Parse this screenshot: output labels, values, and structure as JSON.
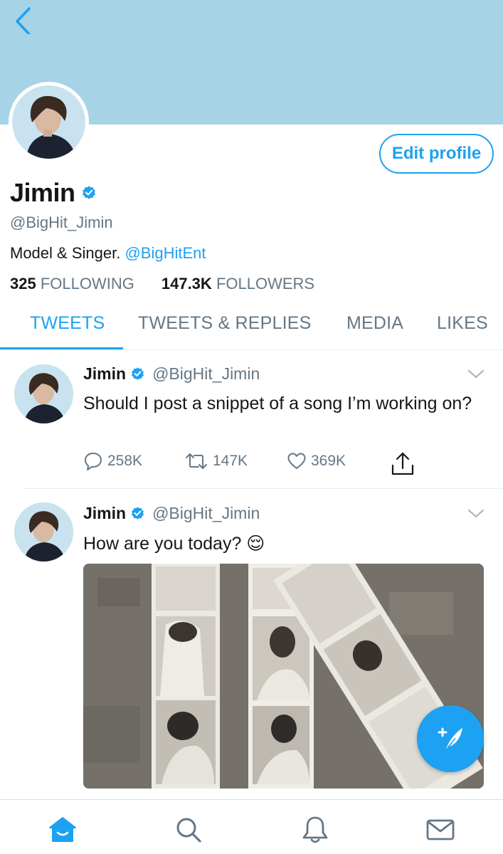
{
  "colors": {
    "accent": "#1da1f2",
    "banner": "#a7d3e6",
    "muted": "#657786",
    "text": "#14171a"
  },
  "header": {
    "back_icon": "chevron-left-icon"
  },
  "profile": {
    "edit_label": "Edit profile",
    "name": "Jimin",
    "handle": "@BigHit_Jimin",
    "bio_text": "Model & Singer.",
    "bio_mention": "@BigHitEnt",
    "following_count": "325",
    "following_label": "FOLLOWING",
    "followers_count": "147.3K",
    "followers_label": "FOLLOWERS",
    "verified_icon": "verified-badge-icon"
  },
  "tabs": [
    {
      "label": "TWEETS",
      "active": true
    },
    {
      "label": "TWEETS & REPLIES",
      "active": false
    },
    {
      "label": "MEDIA",
      "active": false
    },
    {
      "label": "LIKES",
      "active": false
    }
  ],
  "tweets": [
    {
      "name": "Jimin",
      "handle": "@BigHit_Jimin",
      "text": "Should I post a snippet of a song I’m working on?",
      "replies": "258K",
      "retweets": "147K",
      "likes": "369K"
    },
    {
      "name": "Jimin",
      "handle": "@BigHit_Jimin",
      "text": "How are you today? 😌",
      "has_photo": true
    }
  ],
  "fab": {
    "icon": "compose-tweet-icon"
  },
  "bottom_nav": [
    {
      "icon": "home-icon",
      "active": true
    },
    {
      "icon": "search-icon",
      "active": false
    },
    {
      "icon": "bell-icon",
      "active": false
    },
    {
      "icon": "mail-icon",
      "active": false
    }
  ]
}
